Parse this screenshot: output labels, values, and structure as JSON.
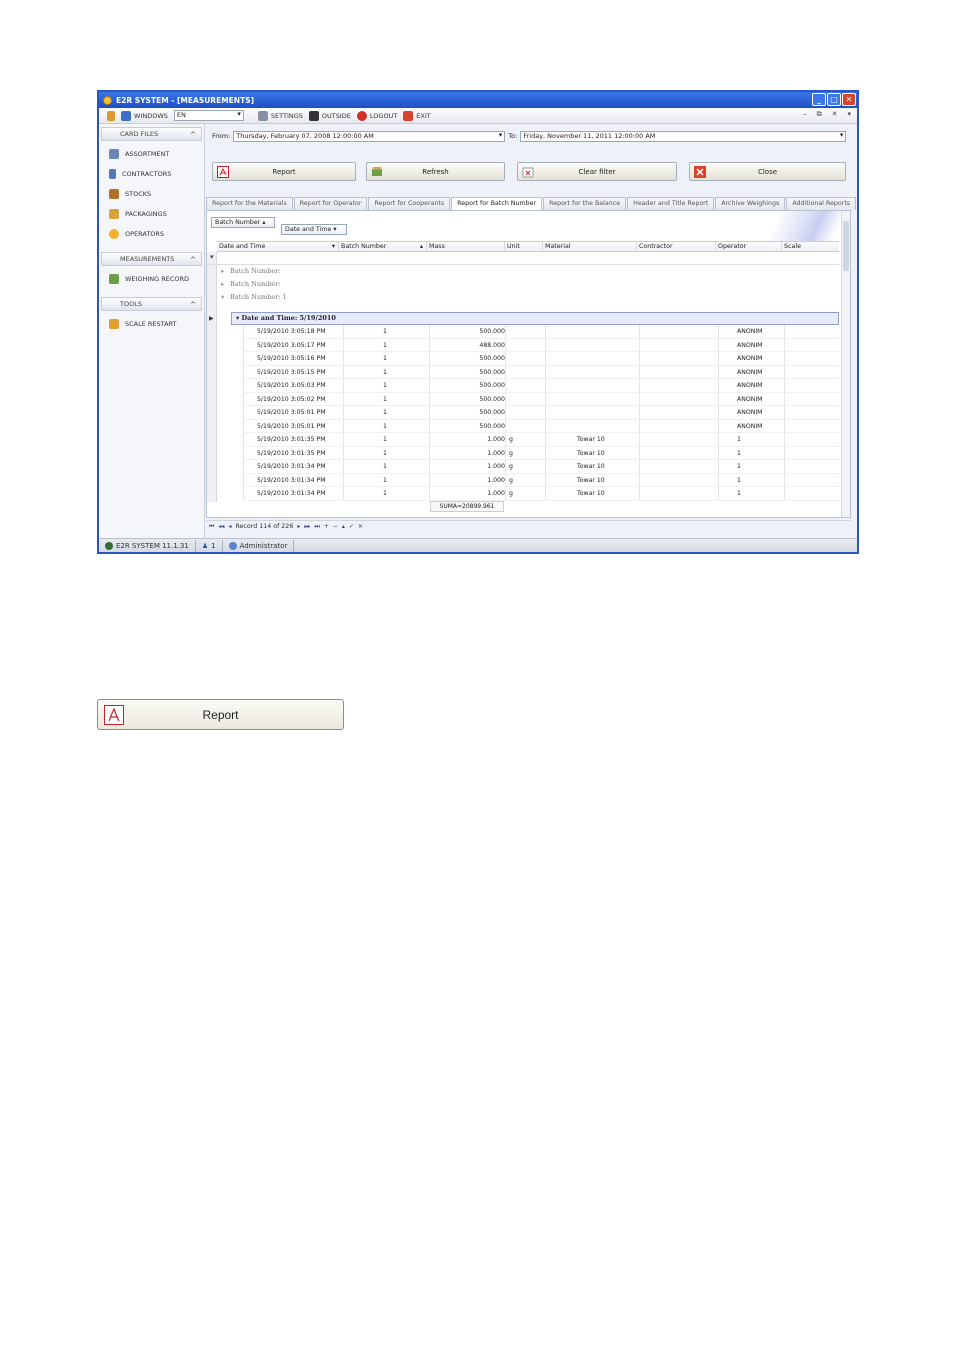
{
  "window": {
    "title": "E2R SYSTEM - [MEASUREMENTS]"
  },
  "menu": {
    "windows": "WINDOWS",
    "language": "EN",
    "settings": "SETTINGS",
    "outside": "OUTSIDE",
    "logout": "LOGOUT",
    "exit": "EXIT"
  },
  "sidebar": {
    "card_files": "CARD FILES",
    "items": [
      "ASSORTMENT",
      "CONTRACTORS",
      "STOCKS",
      "PACKAGINGS",
      "OPERATORS"
    ],
    "measurements": "MEASUREMENTS",
    "measurement_items": [
      "WEIGHING RECORD"
    ],
    "tools": "TOOLS",
    "tool_items": [
      "SCALE RESTART"
    ]
  },
  "filter": {
    "from_label": "From:",
    "from_value": "Thursday, February 07, 2008 12:00:00 AM",
    "to_label": "To:",
    "to_value": "Friday, November 11, 2011 12:00:00 AM"
  },
  "actions": {
    "report": "Report",
    "refresh": "Refresh",
    "clear_filter": "Clear filter",
    "close": "Close"
  },
  "tabs": [
    "Report for the Materials",
    "Report for Operator",
    "Report for Cooperants",
    "Report for Batch Number",
    "Report for the Balance",
    "Header and Title Report",
    "Archive Weighings",
    "Additional Reports"
  ],
  "group_by": {
    "pill1": "Batch Number",
    "pill2": "Date and Time"
  },
  "columns": [
    "Date and Time",
    "Batch Number",
    "Mass",
    "Unit",
    "Material",
    "Contractor",
    "Operator",
    "Scale"
  ],
  "groups": [
    "Batch Number:",
    "Batch Number:",
    "Batch Number: 1"
  ],
  "date_group": "Date and Time: 5/19/2010",
  "rows": [
    {
      "dt": "5/19/2010 3:05:18 PM",
      "batch": "1",
      "mass": "500.000",
      "unit": "",
      "material": "",
      "operator": "ANONIM"
    },
    {
      "dt": "5/19/2010 3:05:17 PM",
      "batch": "1",
      "mass": "488.000",
      "unit": "",
      "material": "",
      "operator": "ANONIM"
    },
    {
      "dt": "5/19/2010 3:05:16 PM",
      "batch": "1",
      "mass": "500.000",
      "unit": "",
      "material": "",
      "operator": "ANONIM"
    },
    {
      "dt": "5/19/2010 3:05:15 PM",
      "batch": "1",
      "mass": "500.000",
      "unit": "",
      "material": "",
      "operator": "ANONIM"
    },
    {
      "dt": "5/19/2010 3:05:03 PM",
      "batch": "1",
      "mass": "500.000",
      "unit": "",
      "material": "",
      "operator": "ANONIM"
    },
    {
      "dt": "5/19/2010 3:05:02 PM",
      "batch": "1",
      "mass": "500.000",
      "unit": "",
      "material": "",
      "operator": "ANONIM"
    },
    {
      "dt": "5/19/2010 3:05:01 PM",
      "batch": "1",
      "mass": "500.000",
      "unit": "",
      "material": "",
      "operator": "ANONIM"
    },
    {
      "dt": "5/19/2010 3:05:01 PM",
      "batch": "1",
      "mass": "500.000",
      "unit": "",
      "material": "",
      "operator": "ANONIM"
    },
    {
      "dt": "5/19/2010 3:01:35 PM",
      "batch": "1",
      "mass": "1.000",
      "unit": "g",
      "material": "Towar 10",
      "operator": "1"
    },
    {
      "dt": "5/19/2010 3:01:35 PM",
      "batch": "1",
      "mass": "1.000",
      "unit": "g",
      "material": "Towar 10",
      "operator": "1"
    },
    {
      "dt": "5/19/2010 3:01:34 PM",
      "batch": "1",
      "mass": "1.000",
      "unit": "g",
      "material": "Towar 10",
      "operator": "1"
    },
    {
      "dt": "5/19/2010 3:01:34 PM",
      "batch": "1",
      "mass": "1.000",
      "unit": "g",
      "material": "Towar 10",
      "operator": "1"
    },
    {
      "dt": "5/19/2010 3:01:34 PM",
      "batch": "1",
      "mass": "1.000",
      "unit": "g",
      "material": "Towar 10",
      "operator": "1"
    }
  ],
  "summary": "SUMA=20899.961",
  "nav": {
    "record": "Record 114 of 226"
  },
  "status": {
    "version": "E2R SYSTEM 11.1.31",
    "users": "1",
    "user": "Administrator"
  },
  "standalone_button": {
    "label": "Report"
  },
  "colors": {
    "titlebar": "#1d4fc4",
    "close": "#d8442b",
    "pdf": "#c8202a"
  }
}
